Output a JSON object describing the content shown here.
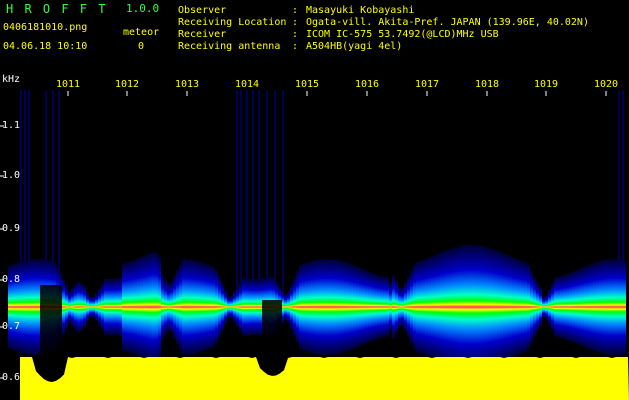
{
  "app": {
    "title": "H R O F F T",
    "version": "1.0.0"
  },
  "file": {
    "name": "0406181010.png",
    "timestamp": "04.06.18 10:10"
  },
  "meteor": {
    "label": "meteor",
    "count": "0"
  },
  "info": {
    "observer_label": "Observer",
    "observer_value": "Masayuki Kobayashi",
    "location_label": "Receiving Location",
    "location_value": "Ogata-vill. Akita-Pref. JAPAN (139.96E, 40.02N)",
    "receiver_label": "Receiver",
    "receiver_value": "ICOM IC-575 53.7492(@LCD)MHz USB",
    "antenna_label": "Receiving antenna",
    "antenna_value": "A504HB(yagi 4el)"
  },
  "axis": {
    "unit": "kHz",
    "y_ticks": [
      "1.1",
      "1.0",
      "0.9",
      "0.8",
      "0.7",
      "0.6"
    ],
    "x_ticks": [
      "1011",
      "1012",
      "1013",
      "1014",
      "1015",
      "1016",
      "1017",
      "1018",
      "1019",
      "1020"
    ]
  },
  "colors": {
    "text_green": "#33ff33",
    "text_yellow": "#ffff00",
    "signal_core": "#ff3366",
    "noise_floor": "#ffff00"
  }
}
